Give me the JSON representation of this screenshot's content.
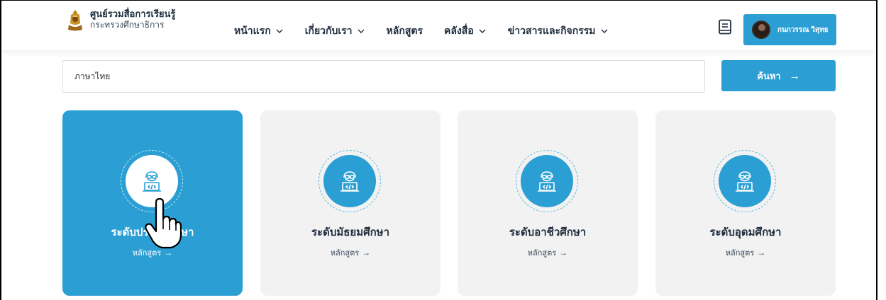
{
  "header": {
    "brand_title": "ศูนย์รวมสื่อการเรียนรู้",
    "brand_subtitle": "กระทรวงศึกษาธิการ",
    "nav": [
      {
        "label": "หน้าแรก",
        "has_dropdown": true
      },
      {
        "label": "เกี่ยวกับเรา",
        "has_dropdown": true
      },
      {
        "label": "หลักสูตร",
        "has_dropdown": false
      },
      {
        "label": "คลังสื่อ",
        "has_dropdown": true
      },
      {
        "label": "ข่าวสารและกิจกรรม",
        "has_dropdown": true
      }
    ],
    "user_name": "กนกวรรณ วิสุทธ"
  },
  "search": {
    "value": "ภาษาไทย",
    "button_label": "ค้นหา",
    "button_arrow": "→"
  },
  "cards": [
    {
      "title": "ระดับประถมศึกษา",
      "link": "หลักสูตร",
      "arrow": "→",
      "active": true
    },
    {
      "title": "ระดับมัธยมศึกษา",
      "link": "หลักสูตร",
      "arrow": "→",
      "active": false
    },
    {
      "title": "ระดับอาชีวศึกษา",
      "link": "หลักสูตร",
      "arrow": "→",
      "active": false
    },
    {
      "title": "ระดับอุดมศึกษา",
      "link": "หลักสูตร",
      "arrow": "→",
      "active": false
    }
  ],
  "colors": {
    "accent": "#2b9fd4",
    "card_bg": "#f2f2f2",
    "text": "#1f2d3d"
  },
  "icons": {
    "logo": "ministry-emblem-icon",
    "nav_chevron": "chevron-down-icon",
    "book": "book-icon",
    "card_icon": "programmer-icon",
    "pointer": "hand-pointer-icon"
  }
}
